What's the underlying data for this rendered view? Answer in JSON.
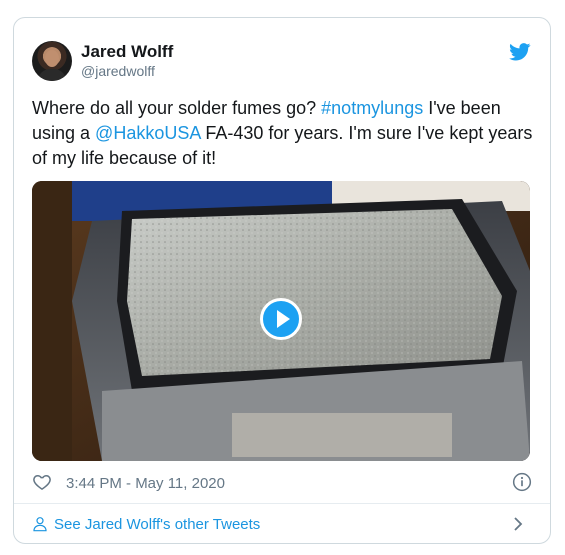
{
  "author": {
    "name": "Jared Wolff",
    "handle": "@jaredwolff"
  },
  "tweet": {
    "text_part1": "Where do all your solder fumes go? ",
    "hashtag": "#notmylungs",
    "text_part2": " I've been using a ",
    "mention": "@HakkoUSA",
    "text_part3": " FA-430 for years. I'm sure I've kept years of my life because of it!"
  },
  "timestamp": "3:44 PM - May 11, 2020",
  "footer": {
    "link_label": "See Jared Wolff's other Tweets"
  },
  "colors": {
    "link": "#1b95e0",
    "brand": "#1da1f2",
    "muted": "#657786",
    "border": "#cfd9de"
  },
  "icons": {
    "brand": "twitter-bird-icon",
    "like": "heart-icon",
    "info": "info-icon",
    "profile": "person-icon",
    "chevron": "chevron-right-icon",
    "play": "play-icon"
  }
}
